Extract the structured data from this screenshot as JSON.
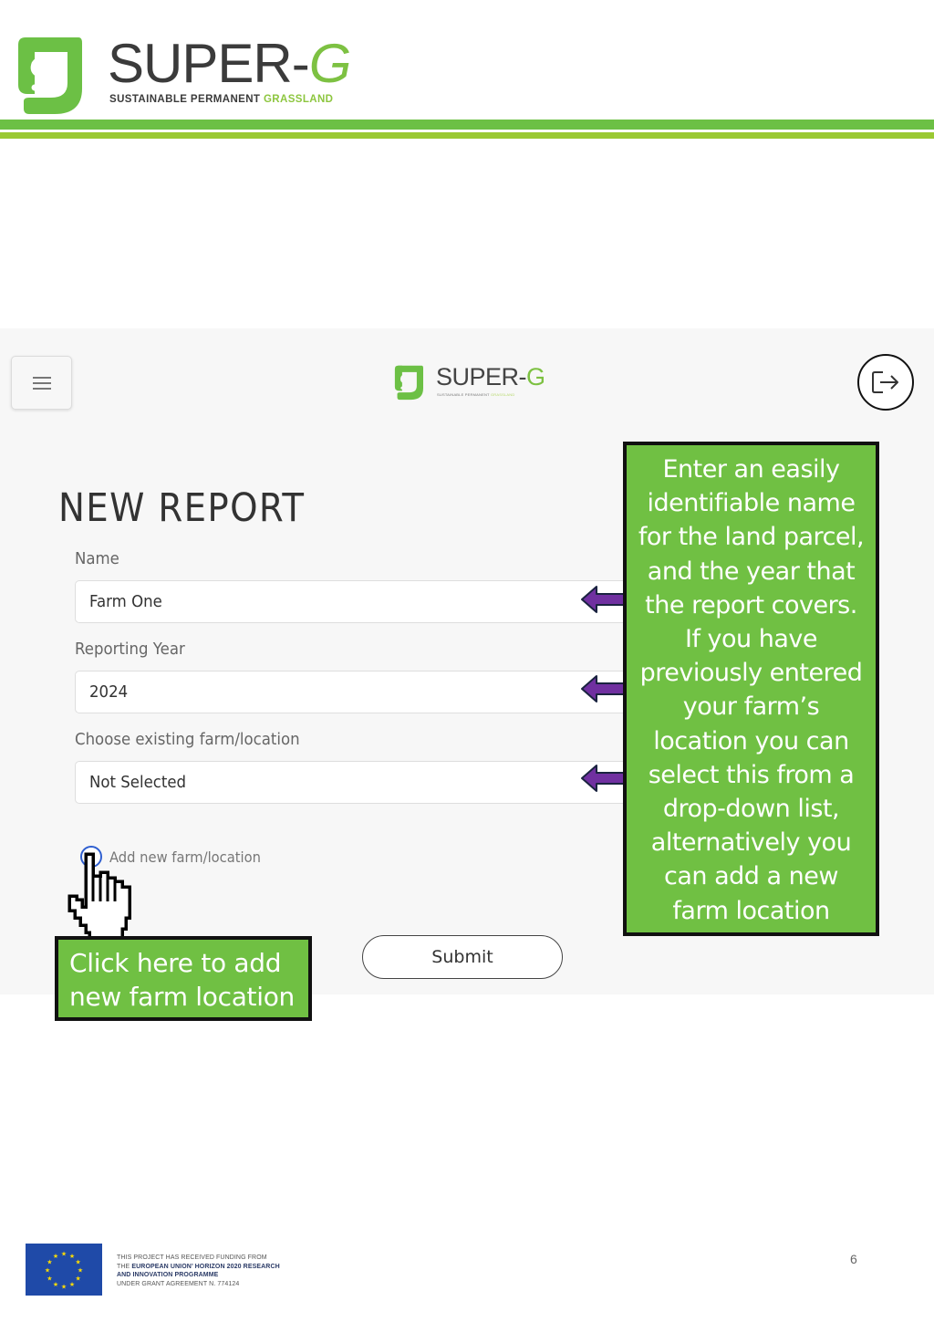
{
  "document": {
    "brand_title_main": "SUPER-",
    "brand_title_accent": "G",
    "brand_subtitle_main": "SUSTAINABLE PERMANENT ",
    "brand_subtitle_accent": "GRASSLAND",
    "colors": {
      "brand_green": "#6cc045",
      "brand_lime": "#9ac933",
      "callout_green": "#70c043",
      "arrow_purple": "#7030a0",
      "eu_blue": "#1f4aa8",
      "eu_star": "#ffdd00"
    }
  },
  "app": {
    "menu_icon": "hamburger-icon",
    "logout_icon": "logout-icon",
    "logo": {
      "title_main": "SUPER-",
      "title_accent": "G",
      "subtitle_main": "SUSTAINABLE PERMANENT ",
      "subtitle_accent": "GRASSLAND"
    },
    "page_title": "NEW REPORT",
    "form": {
      "name_label": "Name",
      "name_value": "Farm One",
      "year_label": "Reporting Year",
      "year_value": "2024",
      "farm_label": "Choose existing farm/location",
      "farm_value": "Not Selected",
      "add_new_label": "Add new farm/location",
      "submit_label": "Submit"
    }
  },
  "annotations": {
    "right_callout_lines": [
      "Enter an easily",
      "identifiable name",
      "for the land parcel,",
      "and the year that",
      "the report covers.",
      "If you have",
      "previously entered",
      "your farm’s",
      "location you can",
      "select this from a",
      "drop-down list,",
      "alternatively you",
      "can add a new",
      "farm location"
    ],
    "left_callout_lines": [
      "Click here to add",
      "new farm location"
    ]
  },
  "footer": {
    "funding_line1": "THIS PROJECT HAS RECEIVED FUNDING FROM",
    "funding_line2_prefix": "THE ",
    "funding_line2_bold": "EUROPEAN UNION’ HORIZON 2020 RESEARCH",
    "funding_line3_bold": "AND INNOVATION PROGRAMME",
    "funding_line4": "UNDER GRANT AGREEMENT N. 774124",
    "page_number": "6"
  }
}
